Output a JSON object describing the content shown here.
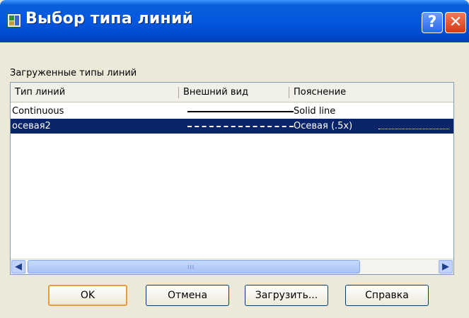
{
  "window": {
    "title": "Выбор типа линий",
    "help_glyph": "?",
    "close_glyph": "✕"
  },
  "group_label": "Загруженные типы линий",
  "list": {
    "columns": [
      "Тип линий",
      "Внешний вид",
      "Пояснение"
    ],
    "rows": [
      {
        "name": "Continuous",
        "appearance": "solid",
        "description": "Solid line",
        "selected": false
      },
      {
        "name": "осевая2",
        "appearance": "center",
        "description": "Осевая (.5x)",
        "selected": true
      }
    ],
    "scroll": {
      "left_glyph": "◀",
      "right_glyph": "▶",
      "grip": "III"
    }
  },
  "buttons": {
    "ok": "OK",
    "cancel": "Отмена",
    "load": "Загрузить...",
    "help": "Справка"
  },
  "colors": {
    "selection": "#0a246a",
    "titlebar": "#0458e0",
    "default_button_border": "#e89c3a"
  }
}
